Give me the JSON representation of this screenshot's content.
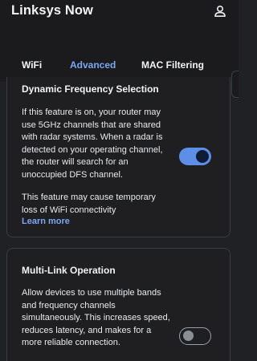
{
  "app": {
    "title": "Linksys Now",
    "account_icon": "person-icon"
  },
  "tabs": [
    {
      "label": "WiFi",
      "active": false
    },
    {
      "label": "Advanced",
      "active": true
    },
    {
      "label": "MAC Filtering",
      "active": false
    }
  ],
  "colors": {
    "accent": "#7aa7f5",
    "toggle_on": "#5d8fe8",
    "background": "#202124"
  },
  "dfs": {
    "title": "Dynamic Frequency Selection",
    "description": "If this feature is on, your router may use 5GHz channels that are shared with radar systems. When a radar is detected on your operating channel, the router will search for an unoccupied DFS channel.",
    "note": "This feature may cause temporary loss of WiFi connectivity",
    "link": "Learn more",
    "enabled": true
  },
  "mlo": {
    "title": "Multi-Link Operation",
    "description": "Allow devices to use multiple bands and frequency channels simultaneously. This increases speed, reduces latency, and makes for a more reliable connection.",
    "enabled": false
  }
}
